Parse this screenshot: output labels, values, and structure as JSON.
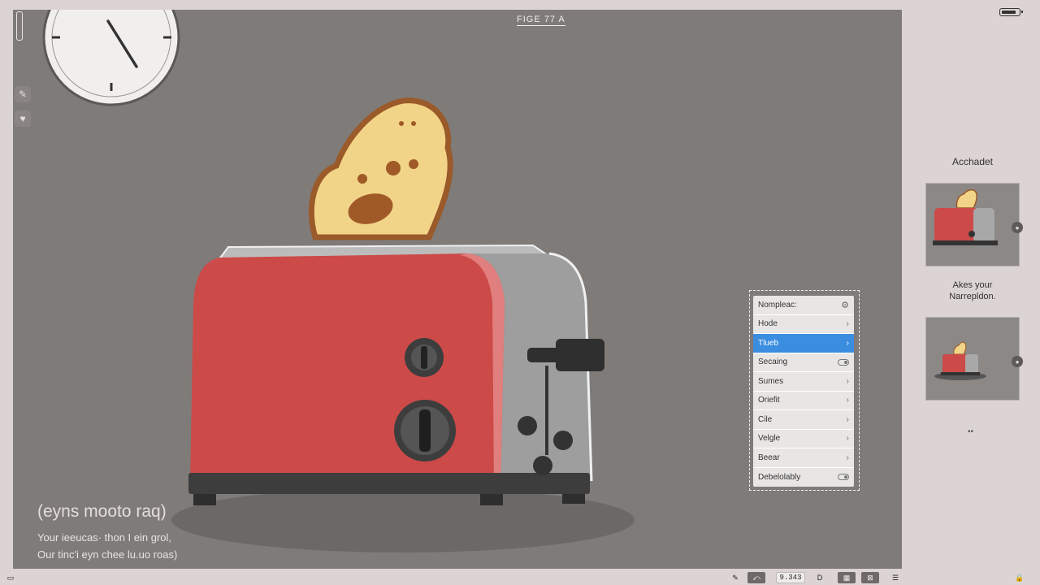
{
  "canvas": {
    "title": "FIGE 77 A",
    "caption_title": "(eyns mooto raq)",
    "caption_line1": "Your ieeucas· thon I ein grol,",
    "caption_line2": "Our tinc'i eyn chee lu.uo roas)"
  },
  "context_menu": {
    "items": [
      {
        "label": "Nompleac:",
        "suffix": "cog"
      },
      {
        "label": "Hode",
        "suffix": "arrow"
      },
      {
        "label": "Tlueb",
        "suffix": "arrow",
        "active": true
      },
      {
        "label": "Secaing",
        "suffix": "toggle"
      },
      {
        "label": "Sumes",
        "suffix": "arrow"
      },
      {
        "label": "Oriefit",
        "suffix": "arrow"
      },
      {
        "label": "Cile",
        "suffix": "arrow"
      },
      {
        "label": "Velgle",
        "suffix": "arrow"
      },
      {
        "label": "Beear",
        "suffix": "arrow"
      },
      {
        "label": "Debelolably",
        "suffix": "toggle"
      }
    ]
  },
  "right_panel": {
    "heading": "Acchadet",
    "note_line1": "Akes your",
    "note_line2": "Narrepldon.",
    "more": "••"
  },
  "bottom_bar": {
    "readout": "9.343",
    "play_glyph": "D"
  },
  "colors": {
    "canvas_bg": "#7f7b79",
    "toaster_red": "#cc4a48",
    "menu_highlight": "#3b8de0"
  }
}
